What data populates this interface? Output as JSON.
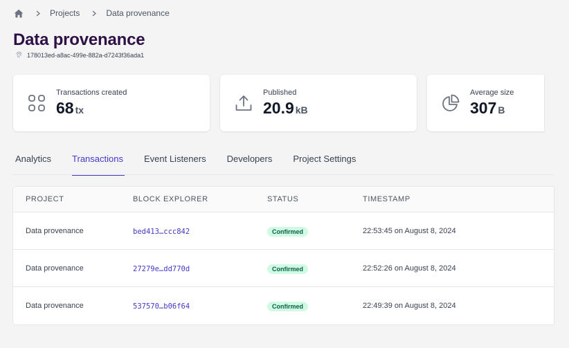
{
  "breadcrumb": {
    "home_icon": "home-icon",
    "items": [
      "Projects",
      "Data provenance"
    ]
  },
  "page": {
    "title": "Data provenance",
    "project_id": "178013ed-a8ac-499e-882a-d7243f36ada1"
  },
  "stats": [
    {
      "icon": "grid-icon",
      "label": "Transactions created",
      "value": "68",
      "unit": "tx"
    },
    {
      "icon": "upload-icon",
      "label": "Published",
      "value": "20.9",
      "unit": "kB"
    },
    {
      "icon": "pie-chart-icon",
      "label": "Average size",
      "value": "307",
      "unit": "B"
    }
  ],
  "tabs": [
    {
      "label": "Analytics",
      "active": false
    },
    {
      "label": "Transactions",
      "active": true
    },
    {
      "label": "Event Listeners",
      "active": false
    },
    {
      "label": "Developers",
      "active": false
    },
    {
      "label": "Project Settings",
      "active": false
    }
  ],
  "table": {
    "headers": [
      "PROJECT",
      "BLOCK EXPLORER",
      "STATUS",
      "TIMESTAMP"
    ],
    "rows": [
      {
        "project": "Data provenance",
        "tx": "bed413…ccc842",
        "status": "Confirmed",
        "timestamp": "22:53:45 on August 8, 2024"
      },
      {
        "project": "Data provenance",
        "tx": "27279e…dd770d",
        "status": "Confirmed",
        "timestamp": "22:52:26 on August 8, 2024"
      },
      {
        "project": "Data provenance",
        "tx": "537570…b06f64",
        "status": "Confirmed",
        "timestamp": "22:49:39 on August 8, 2024"
      }
    ]
  },
  "colors": {
    "title": "#2e1046",
    "accent": "#4338ca",
    "badge_bg": "#d1fae5",
    "badge_text": "#065f46"
  }
}
